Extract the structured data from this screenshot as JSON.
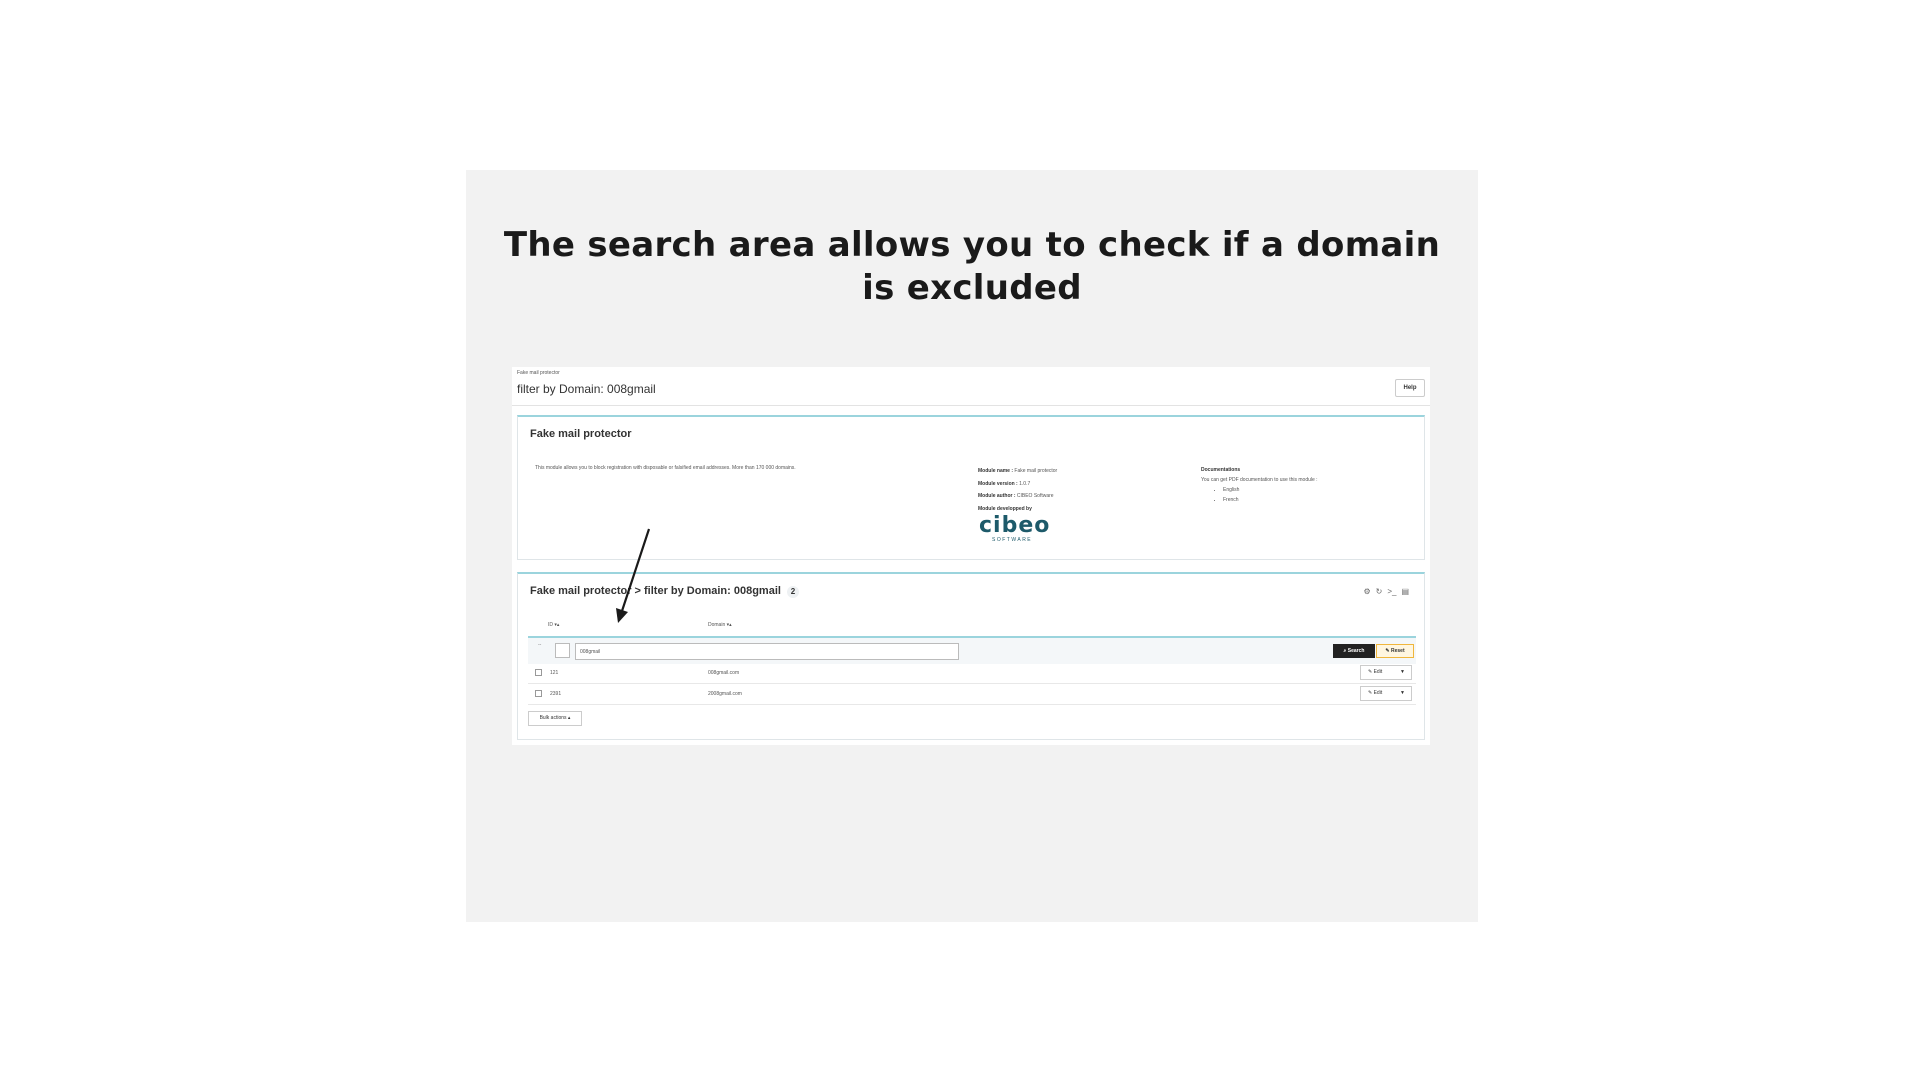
{
  "slide": {
    "headline_line1": "The search area allows you to check if a domain",
    "headline_line2": "is excluded"
  },
  "header": {
    "breadcrumb": "Fake mail protector",
    "title": "filter by Domain: 008gmail",
    "help_label": "Help"
  },
  "info_panel": {
    "title": "Fake mail protector",
    "description": "This module allows you to block registration with disposable or falsified email addresses. More than 170 000 domains.",
    "module_name_label": "Module name :",
    "module_name": "Fake mail protector",
    "module_version_label": "Module version :",
    "module_version": "1.0.7",
    "module_author_label": "Module author :",
    "module_author": "CIBEO Software",
    "developed_by_label": "Module developped by",
    "logo_text": "cibeo",
    "logo_subtext": "SOFTWARE",
    "docs_title": "Documentations",
    "docs_text": "You can get PDF documentation to use this module :",
    "docs_links": [
      "English",
      "French"
    ]
  },
  "list_panel": {
    "title": "Fake mail protector > filter by Domain: 008gmail",
    "count": "2",
    "columns": {
      "id": "ID ▾▴",
      "domain": "Domain ▾▴"
    },
    "filter": {
      "dash": "--",
      "domain_value": "008gmail"
    },
    "search_label": "Search",
    "reset_label": "Reset",
    "rows": [
      {
        "id": "121",
        "domain": "008gmail.com",
        "edit_label": "Edit"
      },
      {
        "id": "2391",
        "domain": "2008gmail.com",
        "edit_label": "Edit"
      }
    ],
    "bulk_actions_label": "Bulk actions ▴"
  },
  "icons": [
    "gear-icon",
    "refresh-icon",
    "terminal-icon",
    "database-icon",
    "search-icon",
    "eraser-icon",
    "pencil-icon",
    "caret-down-icon",
    "arrow-annotation"
  ]
}
